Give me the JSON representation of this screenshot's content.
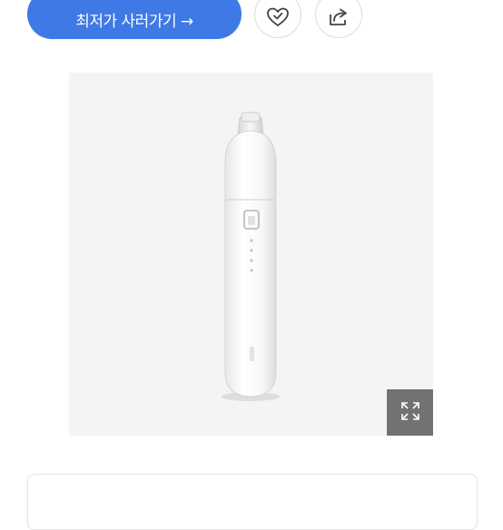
{
  "actions": {
    "buy_label": "최저가 사러가기 →",
    "wishlist_icon": "heart-check-icon",
    "share_icon": "share-arrow-icon"
  },
  "product_image": {
    "description_icon": "product-photo",
    "zoom_icon": "expand-icon"
  },
  "colors": {
    "accent": "#3f79e6",
    "zoom_bg": "#727272",
    "image_bg": "#f4f4f4"
  }
}
